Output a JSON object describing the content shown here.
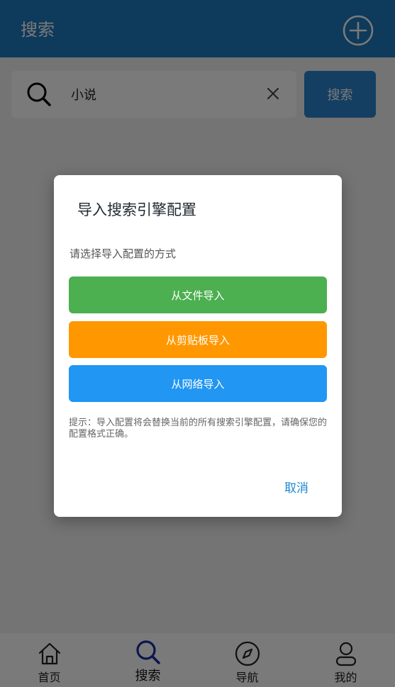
{
  "app_bar": {
    "title": "搜索",
    "add_icon": "plus-circle-icon"
  },
  "search": {
    "value": "小说",
    "placeholder": "",
    "button_label": "搜索",
    "search_icon": "search-icon",
    "clear_icon": "close-icon"
  },
  "dialog": {
    "title": "导入搜索引擎配置",
    "subtitle": "请选择导入配置的方式",
    "buttons": [
      {
        "label": "从文件导入",
        "color": "#4caf50"
      },
      {
        "label": "从剪贴板导入",
        "color": "#ff9800"
      },
      {
        "label": "从网络导入",
        "color": "#2196f3"
      }
    ],
    "tip": "提示：导入配置将会替换当前的所有搜索引擎配置，请确保您的配置格式正确。",
    "cancel_label": "取消"
  },
  "nav": {
    "active_color": "#1a2fa8",
    "items": [
      {
        "label": "首页",
        "icon": "home-icon"
      },
      {
        "label": "搜索",
        "icon": "search-icon",
        "active": true
      },
      {
        "label": "导航",
        "icon": "compass-icon"
      },
      {
        "label": "我的",
        "icon": "user-icon"
      }
    ]
  }
}
